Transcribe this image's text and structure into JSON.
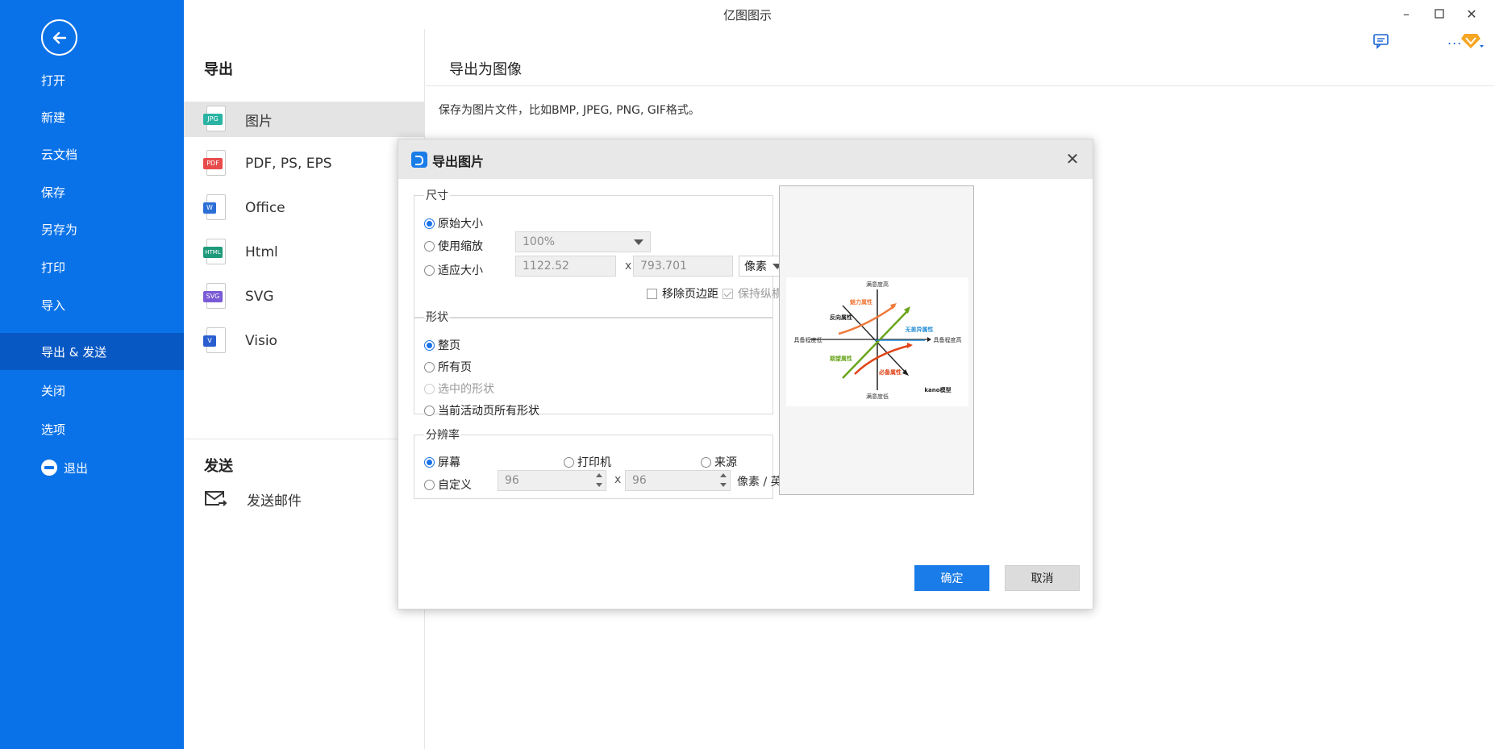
{
  "app": {
    "title": "亿图图示"
  },
  "sidebar": {
    "items": [
      {
        "label": "打开"
      },
      {
        "label": "新建"
      },
      {
        "label": "云文档"
      },
      {
        "label": "保存"
      },
      {
        "label": "另存为"
      },
      {
        "label": "打印"
      },
      {
        "label": "导入"
      },
      {
        "label": "导出 & 发送",
        "active": true
      },
      {
        "label": "关闭"
      },
      {
        "label": "选项"
      },
      {
        "label": "退出"
      }
    ]
  },
  "export": {
    "heading": "导出",
    "items": [
      {
        "label": "图片",
        "tag": "JPG",
        "color": "#2bb3a3",
        "selected": true
      },
      {
        "label": "PDF, PS, EPS",
        "tag": "PDF",
        "color": "#e84b4b"
      },
      {
        "label": "Office",
        "tag": "W",
        "color": "#2b6fd6"
      },
      {
        "label": "Html",
        "tag": "HTML",
        "color": "#1f9a7a"
      },
      {
        "label": "SVG",
        "tag": "SVG",
        "color": "#7a5ad6"
      },
      {
        "label": "Visio",
        "tag": "V",
        "color": "#2b5fcf"
      }
    ],
    "send_heading": "发送",
    "send_mail": "发送邮件"
  },
  "content": {
    "heading": "导出为图像",
    "description": "保存为图片文件，比如BMP, JPEG, PNG, GIF格式。"
  },
  "dialog": {
    "title": "导出图片",
    "size": {
      "legend": "尺寸",
      "original": "原始大小",
      "use_zoom": "使用缩放",
      "zoom_value": "100%",
      "fit_size": "适应大小",
      "width": "1122.52",
      "height": "793.701",
      "x": "x",
      "unit": "像素",
      "remove_margin": "移除页边距",
      "keep_ratio": "保持纵横比"
    },
    "shape": {
      "legend": "形状",
      "whole_page": "整页",
      "all_pages": "所有页",
      "selected_shapes": "选中的形状",
      "current_page_shapes": "当前活动页所有形状"
    },
    "resolution": {
      "legend": "分辨率",
      "screen": "屏幕",
      "printer": "打印机",
      "source": "来源",
      "custom": "自定义",
      "dpi_x": "96",
      "dpi_y": "96",
      "x": "x",
      "unit": "像素 / 英寸"
    },
    "preview": {
      "top": "满意度高",
      "bottom": "满意度低",
      "left": "具备程度低",
      "right": "具备程度高",
      "attractive": "魅力属性",
      "reverse": "反向属性",
      "indifferent": "无差异属性",
      "one_dim": "期望属性",
      "must_be": "必备属性",
      "model": "kano模型"
    },
    "ok": "确定",
    "cancel": "取消"
  }
}
